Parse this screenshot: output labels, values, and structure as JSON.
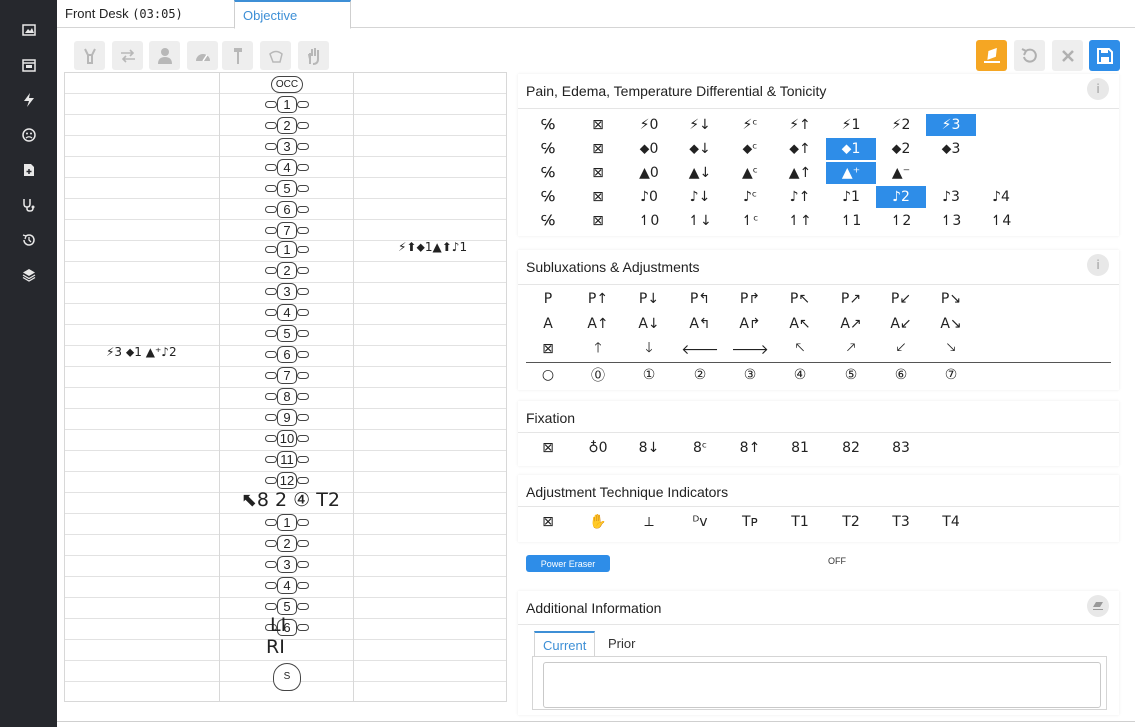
{
  "tabs": [
    {
      "label": "Front Desk",
      "time": "(03:05)"
    },
    {
      "label": "Objective"
    }
  ],
  "sidebar": {
    "items": [
      "image-icon",
      "calendar-icon",
      "bolt-icon",
      "face-icon",
      "file-plus-icon",
      "stethoscope-icon",
      "history-icon",
      "layers-icon"
    ]
  },
  "toolbar": {
    "icons": [
      "vertebra-icon",
      "swap-icon",
      "person-icon",
      "gauge-icon",
      "pin-icon",
      "hand-motion-icon",
      "hand-icon"
    ]
  },
  "actions": {
    "eraser_color": "#f5a623",
    "save_color": "#2e8de8"
  },
  "spine": {
    "top": "OCC",
    "cervical": [
      "1",
      "2",
      "3",
      "4",
      "5",
      "6",
      "7"
    ],
    "thoracic": [
      "1",
      "2",
      "3",
      "4",
      "5",
      "6",
      "7",
      "8",
      "9",
      "10",
      "11",
      "12"
    ],
    "lumbar": [
      "1",
      "2",
      "3",
      "4",
      "5",
      "6"
    ],
    "pelvis": [
      "LI",
      "RI"
    ],
    "sacrum": "S",
    "right_annotation": "⚡⬆⬥1▲⬆♪1",
    "left_annotation": "⚡3 ⬥1 ▲⁺♪2",
    "l1_annotation": "⬉8 2 ④ T2"
  },
  "sections": {
    "pain": {
      "title": "Pain, Edema, Temperature Differential & Tonicity",
      "rows": [
        [
          "℅",
          "⊠",
          "⚡0",
          "⚡↓",
          "⚡ᶜ",
          "⚡↑",
          "⚡1",
          "⚡2",
          "⚡3"
        ],
        [
          "℅",
          "⊠",
          "⬥0",
          "⬥↓",
          "⬥ᶜ",
          "⬥↑",
          "⬥1",
          "⬥2",
          "⬥3"
        ],
        [
          "℅",
          "⊠",
          "▲0",
          "▲↓",
          "▲ᶜ",
          "▲↑",
          "▲⁺",
          "▲⁻"
        ],
        [
          "℅",
          "⊠",
          "♪0",
          "♪↓",
          "♪ᶜ",
          "♪↑",
          "♪1",
          "♪2",
          "♪3",
          "♪4"
        ],
        [
          "℅",
          "⊠",
          "↿0",
          "↿↓",
          "↿ᶜ",
          "↿↑",
          "↿1",
          "↿2",
          "↿3",
          "↿4"
        ]
      ]
    },
    "sublux": {
      "title": "Subluxations & Adjustments",
      "rows": [
        [
          "P",
          "P↑",
          "P↓",
          "P↰",
          "P↱",
          "P↖",
          "P↗",
          "P↙",
          "P↘"
        ],
        [
          "A",
          "A↑",
          "A↓",
          "A↰",
          "A↱",
          "A↖",
          "A↗",
          "A↙",
          "A↘"
        ],
        [
          "⊠",
          "🡑",
          "🡓",
          "🡐",
          "🡒",
          "🡔",
          "🡕",
          "🡗",
          "🡖"
        ],
        [
          "○",
          "⓪",
          "①",
          "②",
          "③",
          "④",
          "⑤",
          "⑥",
          "⑦"
        ]
      ]
    },
    "fixation": {
      "title": "Fixation",
      "items": [
        "⊠",
        "♁0",
        "8↓",
        "8ᶜ",
        "8↑",
        "81",
        "82",
        "83"
      ]
    },
    "technique": {
      "title": "Adjustment Technique Indicators",
      "items": [
        "⊠",
        "✋",
        "⟂",
        "ᴰv",
        "Tᴘ",
        "T1",
        "T2",
        "T3",
        "T4"
      ]
    },
    "power_eraser": {
      "label": "Power Eraser",
      "status": "OFF"
    },
    "additional": {
      "title": "Additional Information",
      "tabs": [
        "Current",
        "Prior"
      ]
    }
  }
}
